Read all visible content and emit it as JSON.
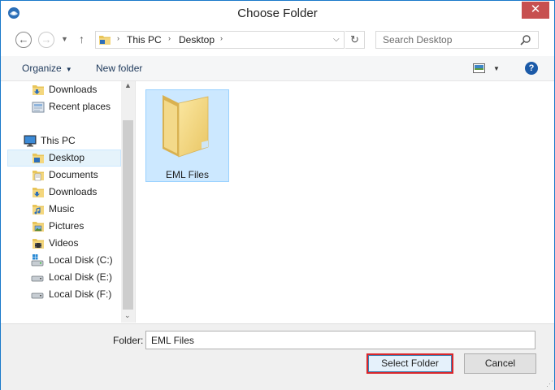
{
  "window": {
    "title": "Choose Folder",
    "close_glyph": "✕"
  },
  "nav": {
    "back_glyph": "←",
    "forward_glyph": "→",
    "recent_glyph": "▼",
    "up_glyph": "↑",
    "breadcrumb": [
      "This PC",
      "Desktop"
    ],
    "crumb_sep": "›",
    "address_drop_glyph": "⌵",
    "refresh_glyph": "↻",
    "search_placeholder": "Search Desktop"
  },
  "toolbar": {
    "organize_label": "Organize",
    "new_folder_label": "New folder",
    "caret": "▼",
    "help_glyph": "?"
  },
  "sidebar": {
    "items": [
      {
        "label": "Downloads",
        "icon": "downloads-folder-icon"
      },
      {
        "label": "Recent places",
        "icon": "recent-places-icon"
      },
      {
        "label": "This PC",
        "icon": "computer-icon"
      },
      {
        "label": "Desktop",
        "icon": "desktop-folder-icon",
        "selected": true
      },
      {
        "label": "Documents",
        "icon": "documents-folder-icon"
      },
      {
        "label": "Downloads",
        "icon": "downloads-folder-icon"
      },
      {
        "label": "Music",
        "icon": "music-folder-icon"
      },
      {
        "label": "Pictures",
        "icon": "pictures-folder-icon"
      },
      {
        "label": "Videos",
        "icon": "videos-folder-icon"
      },
      {
        "label": "Local Disk (C:)",
        "icon": "system-drive-icon"
      },
      {
        "label": "Local Disk (E:)",
        "icon": "drive-icon"
      },
      {
        "label": "Local Disk (F:)",
        "icon": "drive-icon"
      }
    ],
    "scroll_up_glyph": "▲",
    "scroll_down_glyph": "⌄"
  },
  "content": {
    "items": [
      {
        "label": "EML Files",
        "icon": "folder-icon",
        "selected": true
      }
    ]
  },
  "footer": {
    "folder_label": "Folder:",
    "folder_value": "EML Files",
    "select_label": "Select Folder",
    "cancel_label": "Cancel",
    "grip_glyph": "⋰"
  },
  "colors": {
    "accent": "#1979ca",
    "selection": "#cce8ff",
    "highlight_border": "#d9262b",
    "close": "#c75050"
  }
}
